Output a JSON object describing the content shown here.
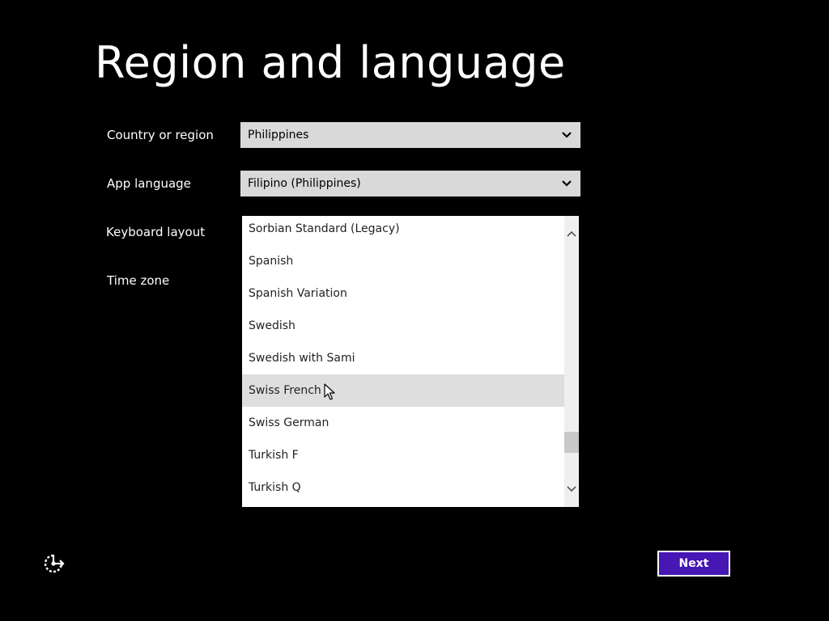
{
  "page": {
    "title": "Region and language"
  },
  "fields": {
    "country": {
      "label": "Country or region",
      "value": "Philippines"
    },
    "app_language": {
      "label": "App language",
      "value": "Filipino (Philippines)"
    },
    "keyboard": {
      "label": "Keyboard layout"
    },
    "timezone": {
      "label": "Time zone"
    }
  },
  "keyboard_list": {
    "items": [
      "Sorbian Standard (Legacy)",
      "Spanish",
      "Spanish Variation",
      "Swedish",
      "Swedish with Sami",
      "Swiss French",
      "Swiss German",
      "Turkish F",
      "Turkish Q"
    ],
    "hovered_item": "Swiss French"
  },
  "footer": {
    "next_label": "Next",
    "accessibility_icon": "ease-of-access-icon"
  },
  "colors": {
    "background": "#000000",
    "accent": "#4617b4",
    "select_bg": "#d9d9d9",
    "hover_bg": "#dedede"
  }
}
